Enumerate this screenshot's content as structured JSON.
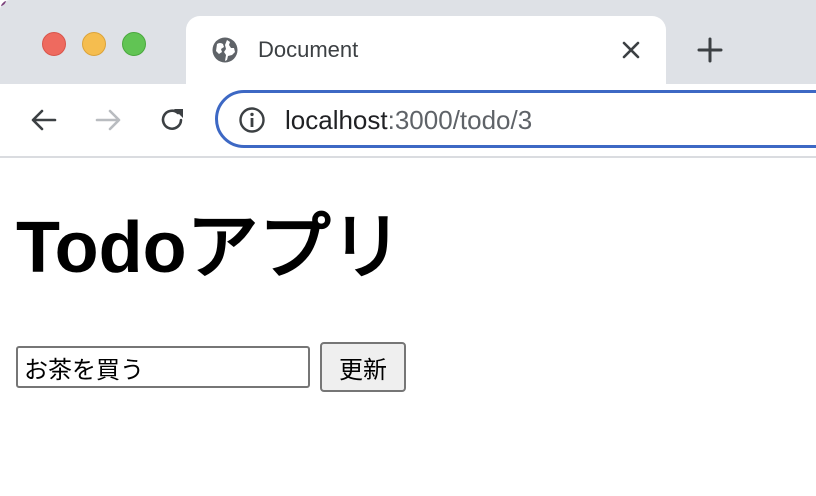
{
  "browser": {
    "tab": {
      "title": "Document",
      "favicon": "globe-icon",
      "close_icon": "close-icon"
    },
    "new_tab_icon": "plus-icon",
    "nav": {
      "back_icon": "arrow-left-icon",
      "forward_icon": "arrow-right-icon",
      "reload_icon": "reload-icon"
    },
    "address_bar": {
      "info_icon": "info-icon",
      "host": "localhost",
      "rest": ":3000/todo/3"
    },
    "colors": {
      "omnibox_focus": "#3d68c4",
      "tab_strip": "#dee1e6",
      "close_light": "#ee6a5f",
      "minimize_light": "#f5bd4f",
      "maximize_light": "#61c454"
    }
  },
  "page": {
    "heading": "Todoアプリ",
    "form": {
      "todo_value": "お茶を買う",
      "submit_label": "更新"
    }
  }
}
